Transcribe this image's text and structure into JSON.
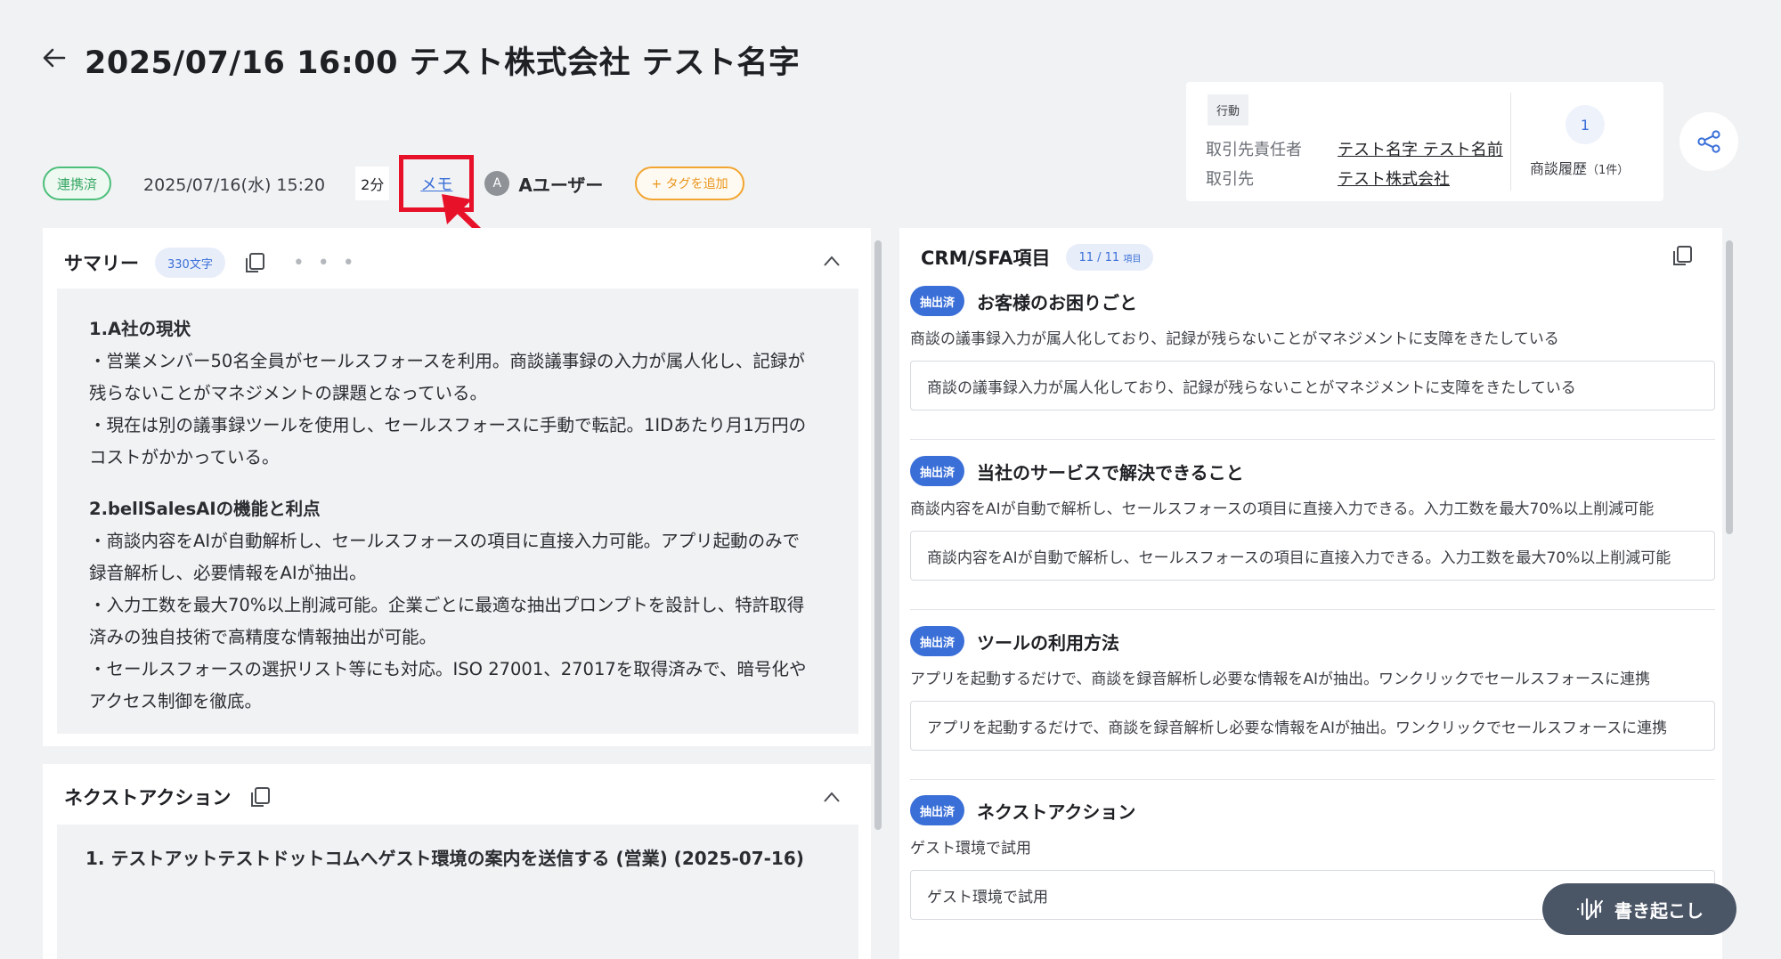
{
  "header": {
    "title": "2025/07/16 16:00 テスト株式会社 テスト名字"
  },
  "meta": {
    "status": "連携済",
    "datetime": "2025/07/16(水) 15:20",
    "duration": "2分",
    "memo_label": "メモ",
    "avatar_initial": "A",
    "user_name": "Aユーザー",
    "add_tag_label": "+ タグを追加"
  },
  "info_card": {
    "action_label": "行動",
    "contact_label": "取引先責任者",
    "contact_value": "テスト名字 テスト名前",
    "account_label": "取引先",
    "account_value": "テスト株式会社",
    "history_count": "1",
    "history_label": "商談履歴",
    "history_suffix": "（1件）"
  },
  "summary": {
    "title": "サマリー",
    "char_count": "330文字",
    "more": "• • •",
    "sections": [
      {
        "heading": "1.A社の現状",
        "lines": [
          "・営業メンバー50名全員がセールスフォースを利用。商談議事録の入力が属人化し、記録が",
          "残らないことがマネジメントの課題となっている。",
          "・現在は別の議事録ツールを使用し、セールスフォースに手動で転記。1IDあたり月1万円の",
          "コストがかかっている。"
        ]
      },
      {
        "heading": "2.bellSalesAIの機能と利点",
        "lines": [
          "・商談内容をAIが自動解析し、セールスフォースの項目に直接入力可能。アプリ起動のみで",
          "録音解析し、必要情報をAIが抽出。",
          "・入力工数を最大70%以上削減可能。企業ごとに最適な抽出プロンプトを設計し、特許取得",
          "済みの独自技術で高精度な情報抽出が可能。",
          "・セールスフォースの選択リスト等にも対応。ISO 27001、27017を取得済みで、暗号化や",
          "アクセス制御を徹底。"
        ]
      }
    ]
  },
  "next_action": {
    "title": "ネクストアクション",
    "item": "1. テストアットテストドットコムへゲスト環境の案内を送信する (営業) (2025-07-16)"
  },
  "crm": {
    "title": "CRM/SFA項目",
    "count": "11 / 11",
    "count_unit": "項目",
    "badge": "抽出済",
    "items": [
      {
        "title": "お客様のお困りごと",
        "desc": "商談の議事録入力が属人化しており、記録が残らないことがマネジメントに支障をきたしている",
        "value": "商談の議事録入力が属人化しており、記録が残らないことがマネジメントに支障をきたしている"
      },
      {
        "title": "当社のサービスで解決できること",
        "desc": "商談内容をAIが自動で解析し、セールスフォースの項目に直接入力できる。入力工数を最大70%以上削減可能",
        "value": "商談内容をAIが自動で解析し、セールスフォースの項目に直接入力できる。入力工数を最大70%以上削減可能"
      },
      {
        "title": "ツールの利用方法",
        "desc": "アプリを起動するだけで、商談を録音解析し必要な情報をAIが抽出。ワンクリックでセールスフォースに連携",
        "value": "アプリを起動するだけで、商談を録音解析し必要な情報をAIが抽出。ワンクリックでセールスフォースに連携"
      },
      {
        "title": "ネクストアクション",
        "desc": "ゲスト環境で試用",
        "value": "ゲスト環境で試用"
      }
    ]
  },
  "transcribe_label": "書き起こし",
  "colors": {
    "accent": "#3a6fd8",
    "status_green": "#4cbf7a",
    "tag_orange": "#f2a530",
    "highlight_red": "#e8112a",
    "fab": "#4a5566"
  }
}
